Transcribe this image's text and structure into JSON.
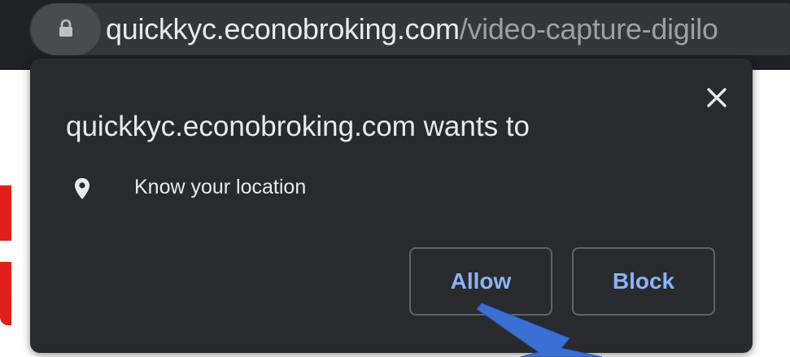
{
  "browser": {
    "url_host": "quickkyc.econobroking.com",
    "url_path": "/video-capture-digilo",
    "lock_icon": "lock-icon"
  },
  "popup": {
    "title": "quickkyc.econobroking.com wants to",
    "permission_icon": "location-pin-icon",
    "permission_text": "Know your location",
    "allow_label": "Allow",
    "block_label": "Block",
    "close_icon": "close-icon"
  },
  "colors": {
    "popup_bg": "#292a2d",
    "button_text": "#8ab4f8",
    "annotation_arrow": "#3b6fd4",
    "page_accent_red": "#e0211b"
  }
}
